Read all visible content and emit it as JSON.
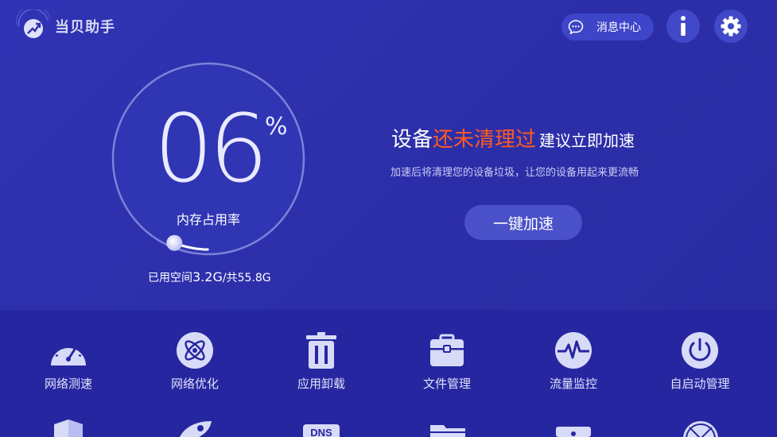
{
  "header": {
    "app_title": "当贝助手",
    "message_center_label": "消息中心",
    "logo_icon": "rocket-badge-icon",
    "info_icon": "info-icon",
    "settings_icon": "gear-icon"
  },
  "gauge": {
    "value_text": "06",
    "percent_sign": "%",
    "label": "内存占用率",
    "usage_prefix": "已用空间",
    "used": "3.2G",
    "separator": "/共",
    "total": "55.8G",
    "fill_fraction": 0.06
  },
  "status": {
    "prefix": "设备",
    "warning": "还未清理过",
    "suffix": "建议立即加速",
    "description": "加速后将清理您的设备垃圾，让您的设备用起来更流畅",
    "button_label": "一键加速"
  },
  "tools": [
    {
      "label": "网络测速",
      "icon": "speedometer-icon"
    },
    {
      "label": "网络优化",
      "icon": "atom-icon"
    },
    {
      "label": "应用卸载",
      "icon": "trash-icon"
    },
    {
      "label": "文件管理",
      "icon": "briefcase-icon"
    },
    {
      "label": "流量监控",
      "icon": "pulse-icon"
    },
    {
      "label": "自启动管理",
      "icon": "power-icon"
    }
  ],
  "tools_row2": [
    {
      "icon": "shield-icon"
    },
    {
      "icon": "rocket-icon"
    },
    {
      "icon": "dns-icon",
      "text": "DNS"
    },
    {
      "icon": "folder-icon"
    },
    {
      "icon": "camera-icon"
    },
    {
      "icon": "globe-icon"
    }
  ],
  "colors": {
    "background": "#2e2fae",
    "bottom_panel": "#2627a0",
    "accent_warning": "#ff5a22",
    "button": "#4a51c9"
  }
}
